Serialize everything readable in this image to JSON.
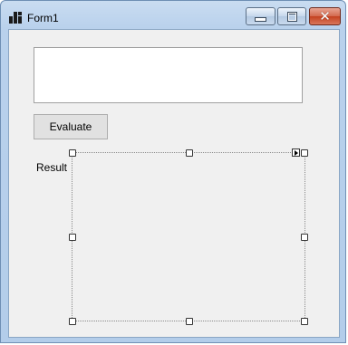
{
  "window": {
    "title": "Form1",
    "buttons": {
      "minimize": "minimize-icon",
      "maximize": "maximize-icon",
      "close": "close-icon"
    },
    "close_glyph": "✕"
  },
  "form": {
    "input_value": "",
    "evaluate_label": "Evaluate",
    "result_label": "Result"
  },
  "colors": {
    "client_background": "#f0f0f0",
    "close_button": "#c4411f"
  }
}
